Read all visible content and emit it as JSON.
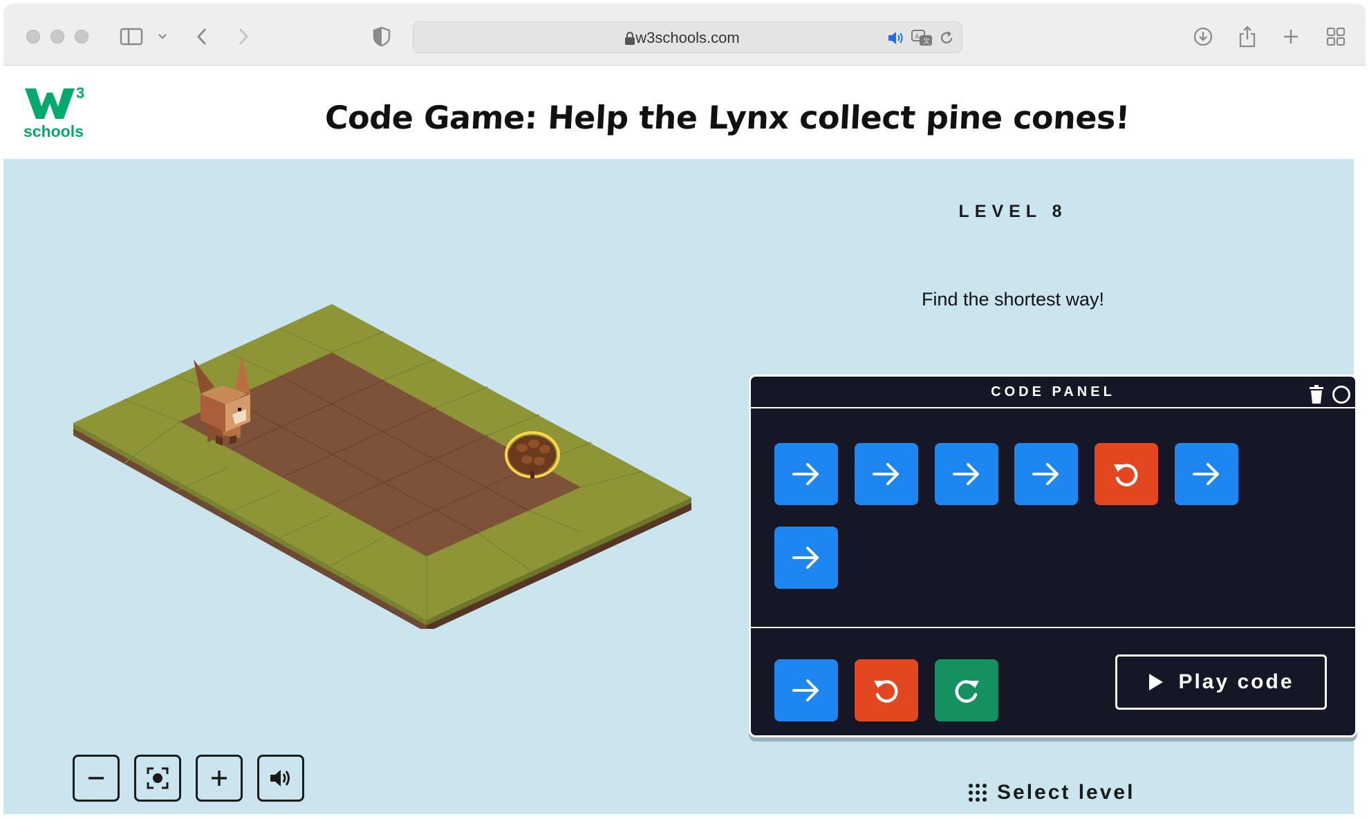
{
  "browser": {
    "url": "w3schools.com",
    "tab_icons": [
      "sidebar-icon",
      "back-icon",
      "forward-icon",
      "shield-icon",
      "download-icon",
      "share-icon",
      "new-tab-icon",
      "tab-overview-icon"
    ]
  },
  "header": {
    "logo_sub": "schools",
    "logo_sup": "3",
    "title": "Code Game: Help the Lynx collect pine cones!"
  },
  "game": {
    "level": "LEVEL 8",
    "hint": "Find the shortest way!"
  },
  "code_panel": {
    "title": "CODE PANEL",
    "program": [
      {
        "command": "forward",
        "color": "#1e86f0",
        "icon": "arrow-right-icon"
      },
      {
        "command": "forward",
        "color": "#1e86f0",
        "icon": "arrow-right-icon"
      },
      {
        "command": "forward",
        "color": "#1e86f0",
        "icon": "arrow-right-icon"
      },
      {
        "command": "forward",
        "color": "#1e86f0",
        "icon": "arrow-right-icon"
      },
      {
        "command": "turn-left",
        "color": "#e3471f",
        "icon": "rotate-left-icon"
      },
      {
        "command": "forward",
        "color": "#1e86f0",
        "icon": "arrow-right-icon"
      },
      {
        "command": "forward",
        "color": "#1e86f0",
        "icon": "arrow-right-icon"
      }
    ],
    "palette": [
      {
        "command": "forward",
        "color": "#1e86f0",
        "icon": "arrow-right-icon"
      },
      {
        "command": "turn-left",
        "color": "#e3471f",
        "icon": "rotate-left-icon"
      },
      {
        "command": "turn-right",
        "color": "#139260",
        "icon": "rotate-right-icon"
      }
    ],
    "play_label": "Play code"
  },
  "controls": {
    "buttons": [
      "zoom-out-icon",
      "recenter-icon",
      "zoom-in-icon",
      "sound-icon"
    ]
  },
  "footer": {
    "select_level_label": "Select level"
  },
  "colors": {
    "background": "#cae5ee",
    "panel": "#151727",
    "forward": "#1e86f0",
    "turn_left": "#e3471f",
    "turn_right": "#139260",
    "grass": "#8a9436",
    "dirt": "#7a5137"
  }
}
